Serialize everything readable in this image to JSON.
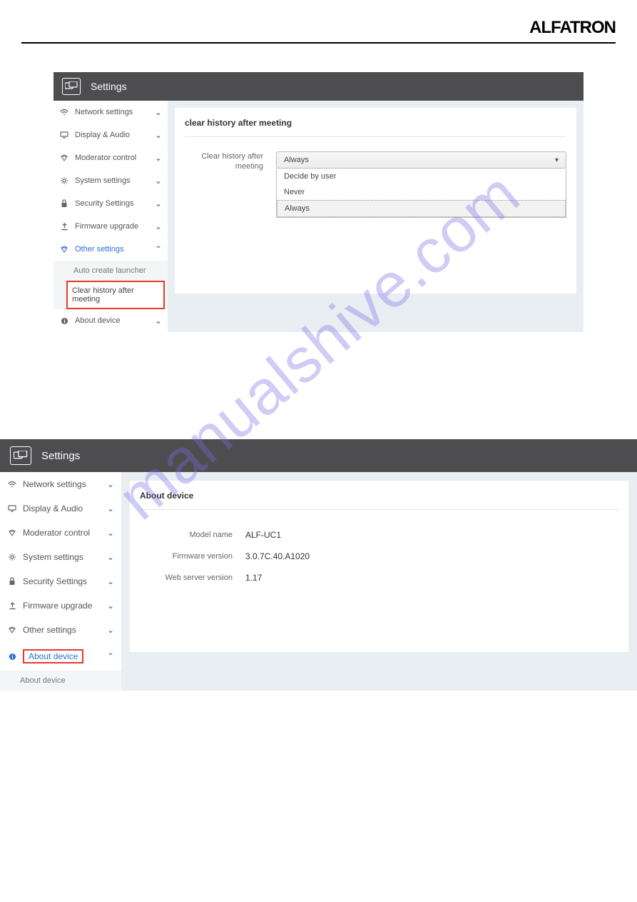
{
  "brand": "ALFATRON",
  "watermark": "manualshive.com",
  "panel1": {
    "title": "Settings",
    "sidebar": {
      "items": [
        {
          "label": "Network settings",
          "icon": "wifi"
        },
        {
          "label": "Display & Audio",
          "icon": "monitor"
        },
        {
          "label": "Moderator control",
          "icon": "diamond"
        },
        {
          "label": "System settings",
          "icon": "gear"
        },
        {
          "label": "Security Settings",
          "icon": "lock"
        },
        {
          "label": "Firmware upgrade",
          "icon": "upload"
        },
        {
          "label": "Other settings",
          "icon": "diamond",
          "active": true
        }
      ],
      "sub_items": [
        {
          "label": "Auto create launcher"
        },
        {
          "label": "Clear history after meeting",
          "highlighted": true
        }
      ],
      "about": {
        "label": "About device",
        "icon": "info"
      }
    },
    "content": {
      "heading": "clear history after meeting",
      "form_label": "Clear history after meeting",
      "selected": "Always",
      "options": [
        "Decide by user",
        "Never",
        "Always"
      ]
    }
  },
  "panel2": {
    "title": "Settings",
    "sidebar": {
      "items": [
        {
          "label": "Network settings",
          "icon": "wifi"
        },
        {
          "label": "Display & Audio",
          "icon": "monitor"
        },
        {
          "label": "Moderator control",
          "icon": "diamond"
        },
        {
          "label": "System settings",
          "icon": "gear"
        },
        {
          "label": "Security Settings",
          "icon": "lock"
        },
        {
          "label": "Firmware upgrade",
          "icon": "upload"
        },
        {
          "label": "Other settings",
          "icon": "diamond"
        },
        {
          "label": "About device",
          "icon": "info",
          "active": true,
          "highlighted": true
        }
      ],
      "sub_items": [
        {
          "label": "About device"
        }
      ]
    },
    "content": {
      "heading": "About device",
      "rows": [
        {
          "label": "Model name",
          "value": "ALF-UC1"
        },
        {
          "label": "Firmware version",
          "value": "3.0.7C.40.A1020"
        },
        {
          "label": "Web server version",
          "value": "1.17"
        }
      ]
    }
  }
}
